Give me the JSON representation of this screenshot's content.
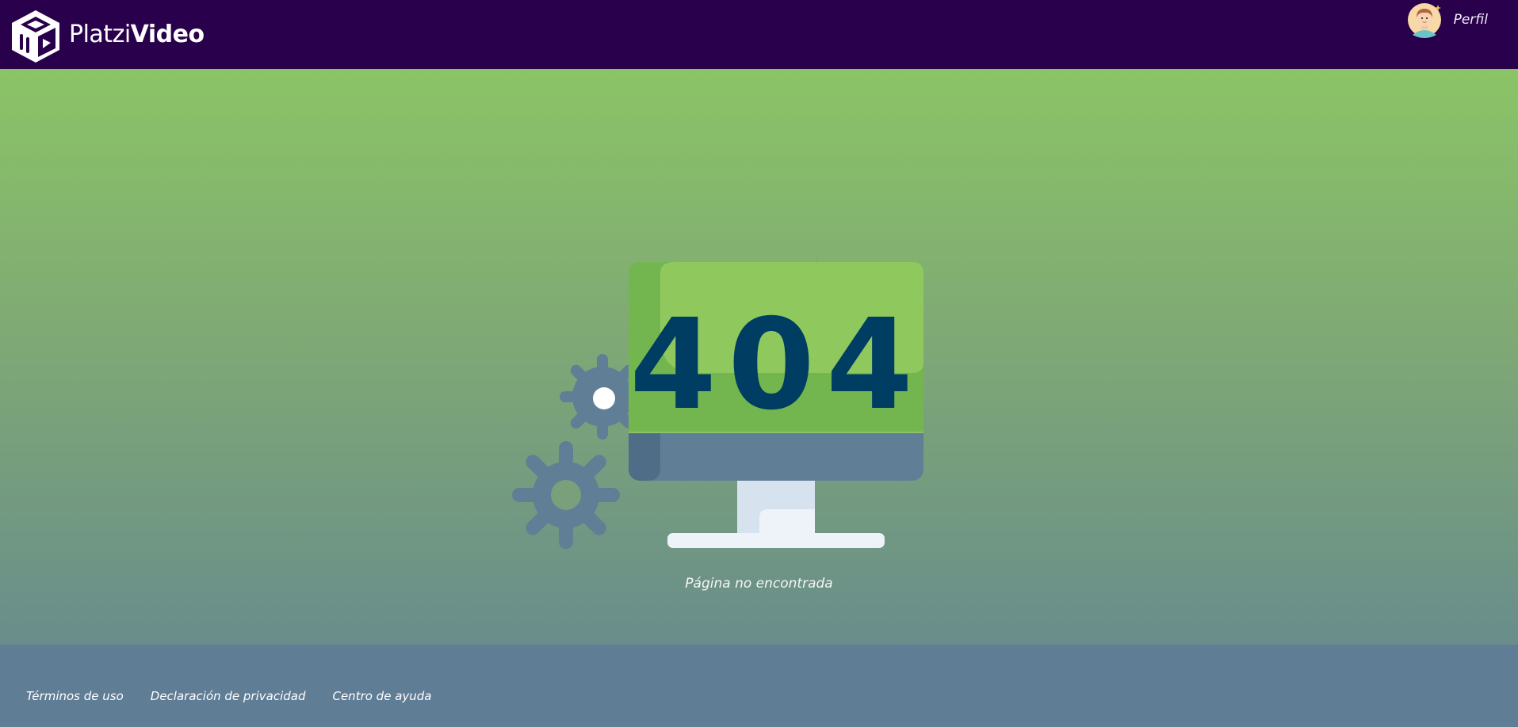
{
  "header": {
    "brand_part1": "Platzi",
    "brand_part2": "Video",
    "profile_label": "Perfil"
  },
  "main": {
    "error_code": "404",
    "message": "Página no encontrada"
  },
  "footer": {
    "links": [
      "Términos de uso",
      "Declaración de privacidad",
      "Centro de ayuda"
    ]
  },
  "icons": {
    "logo": "platzi-video-cube-logo",
    "avatar": "user-avatar",
    "illustration": "monitor-with-gears"
  },
  "colors": {
    "header_bg": "#29004b",
    "footer_bg": "#607d96",
    "gradient_top": "#8bc466",
    "gradient_bottom": "#698d8b"
  }
}
